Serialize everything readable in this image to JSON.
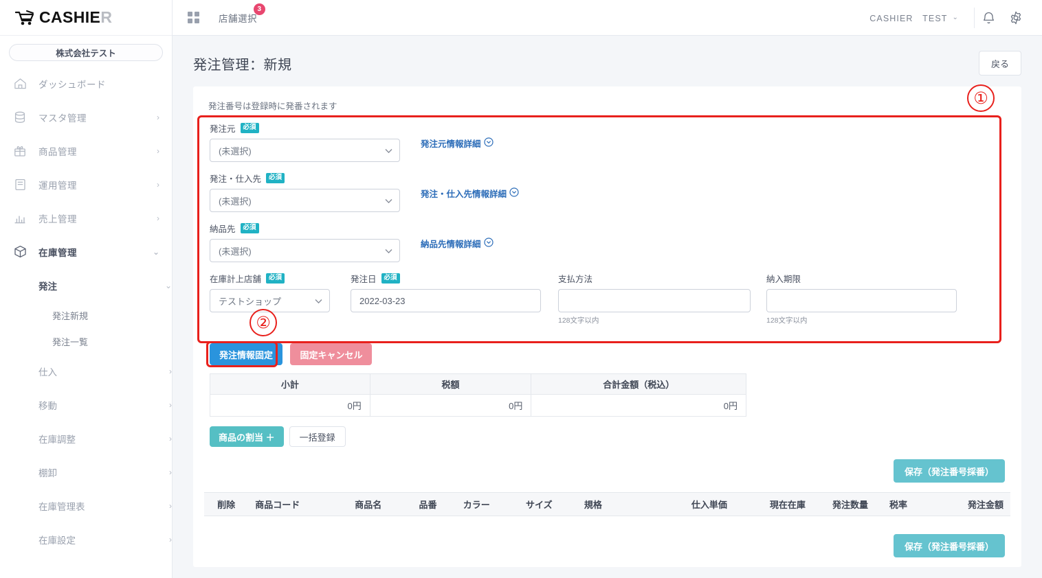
{
  "brand": {
    "name_main": "CASHIE",
    "name_dim": "R",
    "cart_icon": "shopping-cart-icon"
  },
  "sidebar": {
    "company": "株式会社テスト",
    "items": [
      {
        "label": "ダッシュボード",
        "icon": "home-icon",
        "chevron": ""
      },
      {
        "label": "マスタ管理",
        "icon": "database-icon",
        "chevron": "›"
      },
      {
        "label": "商品管理",
        "icon": "gift-icon",
        "chevron": "›"
      },
      {
        "label": "運用管理",
        "icon": "clipboard-icon",
        "chevron": "›"
      },
      {
        "label": "売上管理",
        "icon": "bar-chart-icon",
        "chevron": "›"
      },
      {
        "label": "在庫管理",
        "icon": "box-icon",
        "chevron": "⌄"
      }
    ],
    "sub_group": {
      "label": "発注",
      "chevron": "⌄"
    },
    "sub_items": [
      {
        "label": "発注新規"
      },
      {
        "label": "発注一覧"
      }
    ],
    "tail_items": [
      {
        "label": "仕入",
        "chevron": "›"
      },
      {
        "label": "移動",
        "chevron": "›"
      },
      {
        "label": "在庫調整",
        "chevron": "›"
      },
      {
        "label": "棚卸",
        "chevron": "›"
      },
      {
        "label": "在庫管理表",
        "chevron": "›"
      },
      {
        "label": "在庫設定",
        "chevron": "›"
      }
    ]
  },
  "topbar": {
    "grid_icon": "apps-grid-icon",
    "shop_select": "店舗選択",
    "shop_badge": "3",
    "user": "CASHIER　TEST",
    "user_chevron": "⌄",
    "bell_icon": "bell-icon",
    "gear_icon": "gear-icon"
  },
  "page": {
    "title": "発注管理：新規",
    "back_label": "戻る",
    "hint": "発注番号は登録時に発番されます"
  },
  "annotations": {
    "one": "①",
    "two": "②"
  },
  "form": {
    "orderer": {
      "label": "発注元",
      "required": "必須",
      "value": "(未選択)",
      "detail": "発注元情報詳細"
    },
    "supplier": {
      "label": "発注・仕入先",
      "required": "必須",
      "value": "(未選択)",
      "detail": "発注・仕入先情報詳細"
    },
    "delivery": {
      "label": "納品先",
      "required": "必須",
      "value": "(未選択)",
      "detail": "納品先情報詳細"
    },
    "stock_shop": {
      "label": "在庫計上店舗",
      "required": "必須",
      "value": "テストショップ"
    },
    "order_date": {
      "label": "発注日",
      "required": "必須",
      "value": "2022-03-23"
    },
    "payment": {
      "label": "支払方法",
      "value": "",
      "help": "128文字以内"
    },
    "due_date": {
      "label": "納入期限",
      "value": "",
      "help": "128文字以内"
    }
  },
  "actions": {
    "fix_order": "発注情報固定",
    "cancel_fix": "固定キャンセル",
    "assign_product": "商品の割当 ＋",
    "bulk_register": "一括登録",
    "save_top": "保存（発注番号採番）",
    "save_bottom": "保存（発注番号採番）"
  },
  "summary_table": {
    "headers": [
      "小計",
      "税額",
      "合計金額（税込）"
    ],
    "row": [
      "0円",
      "0円",
      "0円"
    ]
  },
  "product_table": {
    "headers": [
      "削除",
      "商品コード",
      "商品名",
      "品番",
      "カラー",
      "サイズ",
      "規格",
      "仕入単価",
      "現在在庫",
      "発注数量",
      "税率",
      "発注金額"
    ]
  },
  "colors": {
    "accent_teal": "#20b2c4",
    "primary_blue": "#2a94dd",
    "cancel_pink": "#ef8e9c",
    "save_teal": "#65c3cf",
    "assign_teal": "#55bfc4",
    "badge_pink": "#e8476f",
    "annotation_red": "#e8201c",
    "link_blue": "#2b6cb8"
  }
}
